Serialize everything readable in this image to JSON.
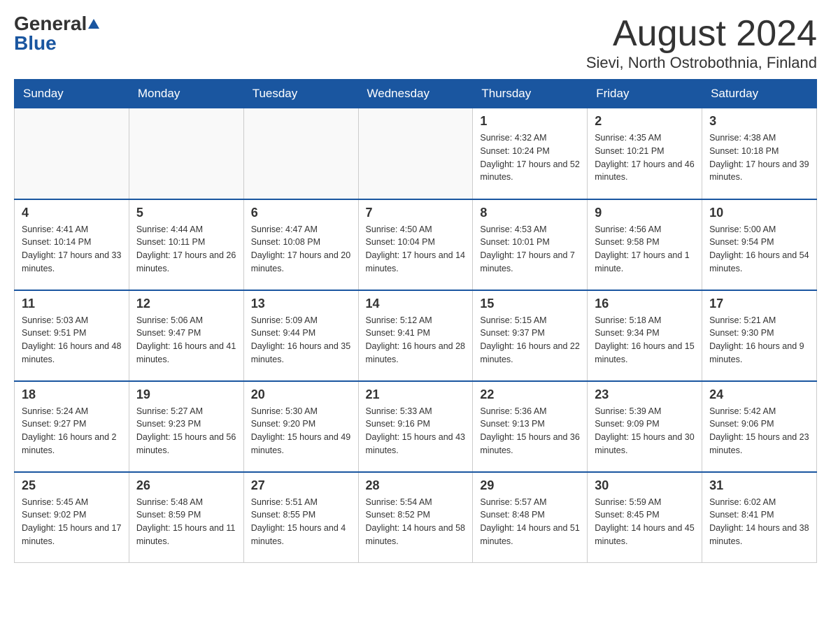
{
  "header": {
    "logo_general": "General",
    "logo_blue": "Blue",
    "month_title": "August 2024",
    "location": "Sievi, North Ostrobothnia, Finland"
  },
  "weekdays": [
    "Sunday",
    "Monday",
    "Tuesday",
    "Wednesday",
    "Thursday",
    "Friday",
    "Saturday"
  ],
  "weeks": [
    [
      {
        "day": "",
        "sunrise": "",
        "sunset": "",
        "daylight": ""
      },
      {
        "day": "",
        "sunrise": "",
        "sunset": "",
        "daylight": ""
      },
      {
        "day": "",
        "sunrise": "",
        "sunset": "",
        "daylight": ""
      },
      {
        "day": "",
        "sunrise": "",
        "sunset": "",
        "daylight": ""
      },
      {
        "day": "1",
        "sunrise": "Sunrise: 4:32 AM",
        "sunset": "Sunset: 10:24 PM",
        "daylight": "Daylight: 17 hours and 52 minutes."
      },
      {
        "day": "2",
        "sunrise": "Sunrise: 4:35 AM",
        "sunset": "Sunset: 10:21 PM",
        "daylight": "Daylight: 17 hours and 46 minutes."
      },
      {
        "day": "3",
        "sunrise": "Sunrise: 4:38 AM",
        "sunset": "Sunset: 10:18 PM",
        "daylight": "Daylight: 17 hours and 39 minutes."
      }
    ],
    [
      {
        "day": "4",
        "sunrise": "Sunrise: 4:41 AM",
        "sunset": "Sunset: 10:14 PM",
        "daylight": "Daylight: 17 hours and 33 minutes."
      },
      {
        "day": "5",
        "sunrise": "Sunrise: 4:44 AM",
        "sunset": "Sunset: 10:11 PM",
        "daylight": "Daylight: 17 hours and 26 minutes."
      },
      {
        "day": "6",
        "sunrise": "Sunrise: 4:47 AM",
        "sunset": "Sunset: 10:08 PM",
        "daylight": "Daylight: 17 hours and 20 minutes."
      },
      {
        "day": "7",
        "sunrise": "Sunrise: 4:50 AM",
        "sunset": "Sunset: 10:04 PM",
        "daylight": "Daylight: 17 hours and 14 minutes."
      },
      {
        "day": "8",
        "sunrise": "Sunrise: 4:53 AM",
        "sunset": "Sunset: 10:01 PM",
        "daylight": "Daylight: 17 hours and 7 minutes."
      },
      {
        "day": "9",
        "sunrise": "Sunrise: 4:56 AM",
        "sunset": "Sunset: 9:58 PM",
        "daylight": "Daylight: 17 hours and 1 minute."
      },
      {
        "day": "10",
        "sunrise": "Sunrise: 5:00 AM",
        "sunset": "Sunset: 9:54 PM",
        "daylight": "Daylight: 16 hours and 54 minutes."
      }
    ],
    [
      {
        "day": "11",
        "sunrise": "Sunrise: 5:03 AM",
        "sunset": "Sunset: 9:51 PM",
        "daylight": "Daylight: 16 hours and 48 minutes."
      },
      {
        "day": "12",
        "sunrise": "Sunrise: 5:06 AM",
        "sunset": "Sunset: 9:47 PM",
        "daylight": "Daylight: 16 hours and 41 minutes."
      },
      {
        "day": "13",
        "sunrise": "Sunrise: 5:09 AM",
        "sunset": "Sunset: 9:44 PM",
        "daylight": "Daylight: 16 hours and 35 minutes."
      },
      {
        "day": "14",
        "sunrise": "Sunrise: 5:12 AM",
        "sunset": "Sunset: 9:41 PM",
        "daylight": "Daylight: 16 hours and 28 minutes."
      },
      {
        "day": "15",
        "sunrise": "Sunrise: 5:15 AM",
        "sunset": "Sunset: 9:37 PM",
        "daylight": "Daylight: 16 hours and 22 minutes."
      },
      {
        "day": "16",
        "sunrise": "Sunrise: 5:18 AM",
        "sunset": "Sunset: 9:34 PM",
        "daylight": "Daylight: 16 hours and 15 minutes."
      },
      {
        "day": "17",
        "sunrise": "Sunrise: 5:21 AM",
        "sunset": "Sunset: 9:30 PM",
        "daylight": "Daylight: 16 hours and 9 minutes."
      }
    ],
    [
      {
        "day": "18",
        "sunrise": "Sunrise: 5:24 AM",
        "sunset": "Sunset: 9:27 PM",
        "daylight": "Daylight: 16 hours and 2 minutes."
      },
      {
        "day": "19",
        "sunrise": "Sunrise: 5:27 AM",
        "sunset": "Sunset: 9:23 PM",
        "daylight": "Daylight: 15 hours and 56 minutes."
      },
      {
        "day": "20",
        "sunrise": "Sunrise: 5:30 AM",
        "sunset": "Sunset: 9:20 PM",
        "daylight": "Daylight: 15 hours and 49 minutes."
      },
      {
        "day": "21",
        "sunrise": "Sunrise: 5:33 AM",
        "sunset": "Sunset: 9:16 PM",
        "daylight": "Daylight: 15 hours and 43 minutes."
      },
      {
        "day": "22",
        "sunrise": "Sunrise: 5:36 AM",
        "sunset": "Sunset: 9:13 PM",
        "daylight": "Daylight: 15 hours and 36 minutes."
      },
      {
        "day": "23",
        "sunrise": "Sunrise: 5:39 AM",
        "sunset": "Sunset: 9:09 PM",
        "daylight": "Daylight: 15 hours and 30 minutes."
      },
      {
        "day": "24",
        "sunrise": "Sunrise: 5:42 AM",
        "sunset": "Sunset: 9:06 PM",
        "daylight": "Daylight: 15 hours and 23 minutes."
      }
    ],
    [
      {
        "day": "25",
        "sunrise": "Sunrise: 5:45 AM",
        "sunset": "Sunset: 9:02 PM",
        "daylight": "Daylight: 15 hours and 17 minutes."
      },
      {
        "day": "26",
        "sunrise": "Sunrise: 5:48 AM",
        "sunset": "Sunset: 8:59 PM",
        "daylight": "Daylight: 15 hours and 11 minutes."
      },
      {
        "day": "27",
        "sunrise": "Sunrise: 5:51 AM",
        "sunset": "Sunset: 8:55 PM",
        "daylight": "Daylight: 15 hours and 4 minutes."
      },
      {
        "day": "28",
        "sunrise": "Sunrise: 5:54 AM",
        "sunset": "Sunset: 8:52 PM",
        "daylight": "Daylight: 14 hours and 58 minutes."
      },
      {
        "day": "29",
        "sunrise": "Sunrise: 5:57 AM",
        "sunset": "Sunset: 8:48 PM",
        "daylight": "Daylight: 14 hours and 51 minutes."
      },
      {
        "day": "30",
        "sunrise": "Sunrise: 5:59 AM",
        "sunset": "Sunset: 8:45 PM",
        "daylight": "Daylight: 14 hours and 45 minutes."
      },
      {
        "day": "31",
        "sunrise": "Sunrise: 6:02 AM",
        "sunset": "Sunset: 8:41 PM",
        "daylight": "Daylight: 14 hours and 38 minutes."
      }
    ]
  ]
}
